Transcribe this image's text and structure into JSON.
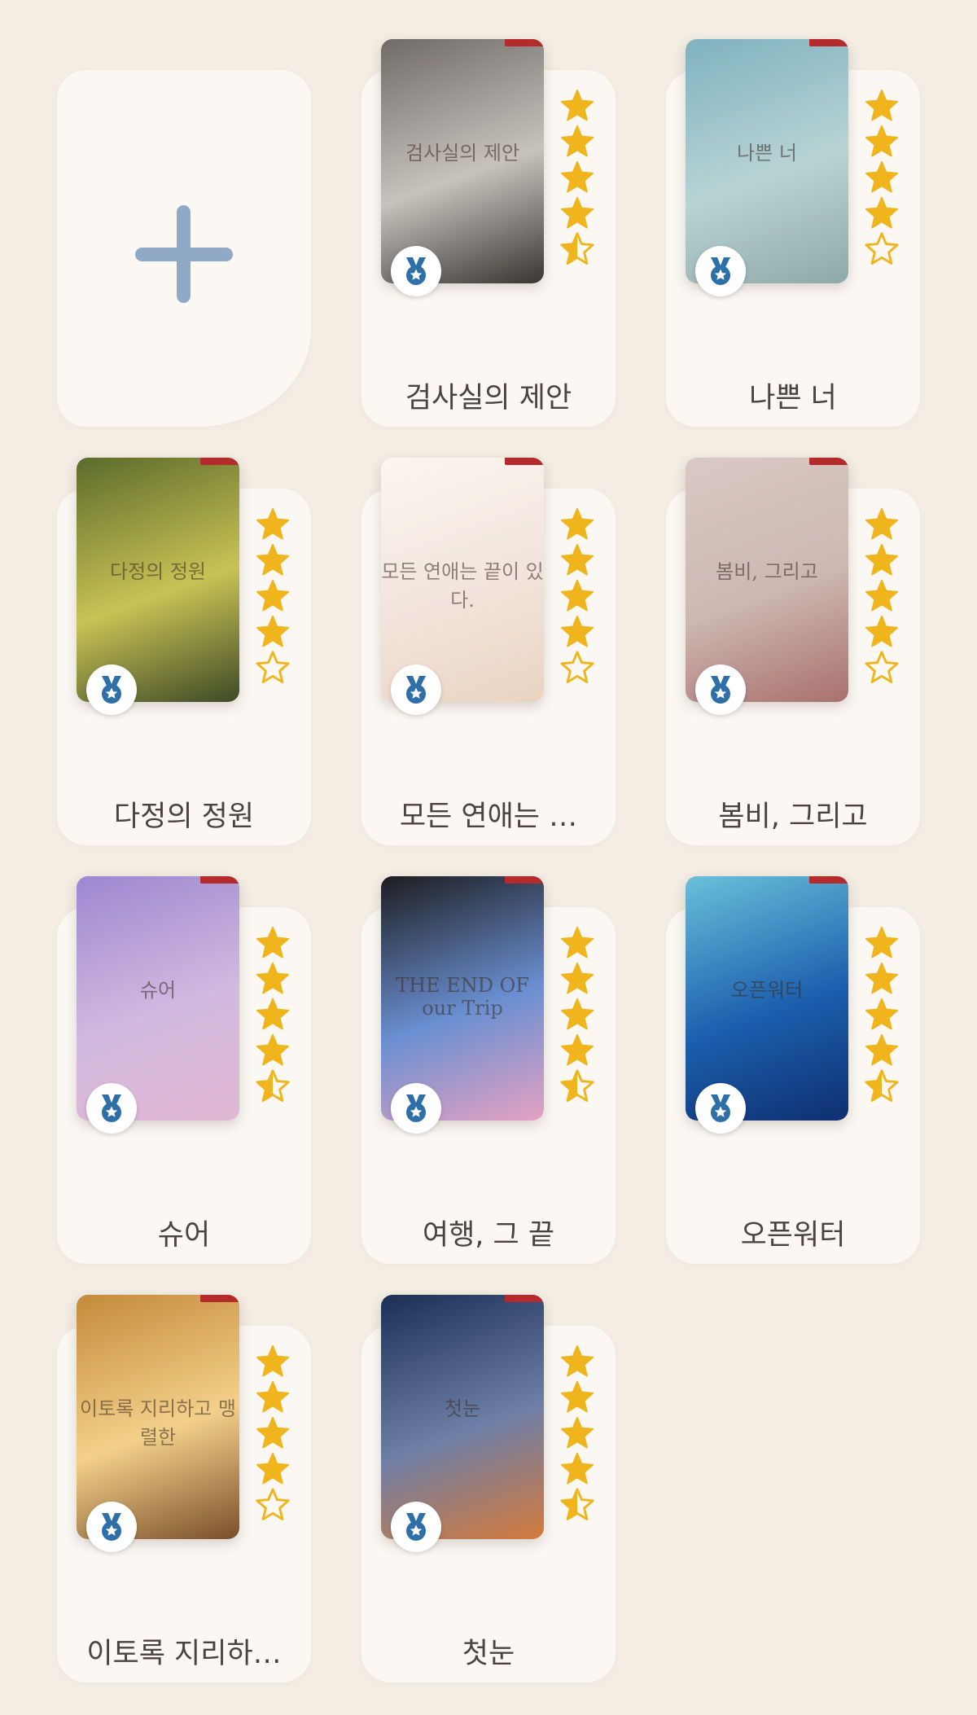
{
  "add_button": {
    "icon": "plus-icon",
    "color": "#8fa9c6"
  },
  "books": [
    {
      "title": "검사실의 제안",
      "rating": 4.5,
      "cover_text": "검사실의 제안",
      "cover_bg": [
        "#6f6b68",
        "#c7c2bb",
        "#3a3533"
      ]
    },
    {
      "title": "나쁜 너",
      "rating": 4,
      "cover_text": "나쁜 너",
      "cover_bg": [
        "#7fb2c0",
        "#b8d3d4",
        "#8fa9a8"
      ]
    },
    {
      "title": "다정의 정원",
      "rating": 4,
      "cover_text": "다정의 정원",
      "cover_bg": [
        "#5b6b2b",
        "#c9c255",
        "#3d4a25"
      ]
    },
    {
      "title": "모든 연애는 …",
      "rating": 4,
      "cover_text": "모든 연애는 끝이 있다.",
      "cover_bg": [
        "#fbf6ef",
        "#f2e4dc",
        "#e9d4c0"
      ]
    },
    {
      "title": "봄비, 그리고",
      "rating": 4,
      "cover_text": "봄비, 그리고",
      "cover_bg": [
        "#d9c9c4",
        "#cdb7b1",
        "#a9706d"
      ]
    },
    {
      "title": "슈어",
      "rating": 4.5,
      "cover_text": "슈어",
      "cover_bg": [
        "#9d87d0",
        "#d2b9e0",
        "#e2b8d3"
      ]
    },
    {
      "title": "여행, 그 끝",
      "rating": 4.5,
      "cover_text": "THE END OF our Trip",
      "cover_bg": [
        "#1d1d20",
        "#6a8fd1",
        "#e5a2c3"
      ]
    },
    {
      "title": "오픈워터",
      "rating": 4.5,
      "cover_text": "오픈워터",
      "cover_bg": [
        "#6bc0da",
        "#1b5fae",
        "#0f2f70"
      ]
    },
    {
      "title": "이토록 지리하…",
      "rating": 4,
      "cover_text": "이토록 지리하고 맹렬한",
      "cover_bg": [
        "#c48a3a",
        "#f3d08a",
        "#7a4f2a"
      ]
    },
    {
      "title": "첫눈",
      "rating": 4.5,
      "cover_text": "첫눈",
      "cover_bg": [
        "#1b2f55",
        "#6e7fa7",
        "#d47a3b"
      ]
    }
  ],
  "colors": {
    "star": "#f0b51d",
    "medal": "#2f6fa8",
    "background": "#f3ede4",
    "card": "#fbf8f4"
  },
  "medal_icon": "medal-icon"
}
